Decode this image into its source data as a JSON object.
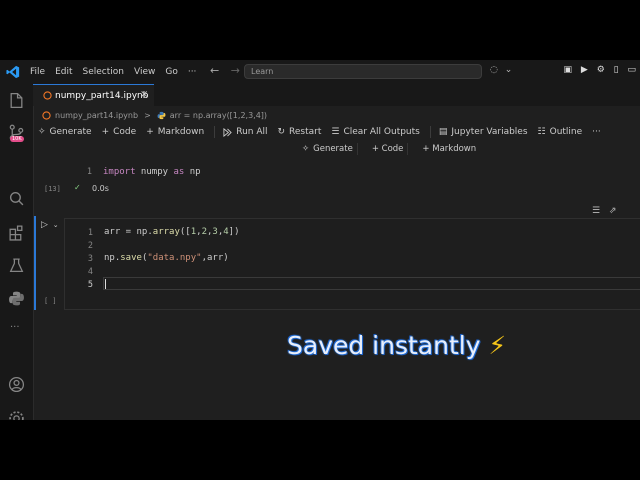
{
  "titlebar": {
    "menu": [
      "File",
      "Edit",
      "Selection",
      "View",
      "Go",
      "···"
    ],
    "search_placeholder": "Learn"
  },
  "tab": {
    "filename": "numpy_part14.ipynb",
    "close": "×"
  },
  "breadcrumb": {
    "file": "numpy_part14.ipynb",
    "sep": ">",
    "cell": "arr = np.array([1,2,3,4])"
  },
  "toolbar": {
    "generate": "Generate",
    "code": "Code",
    "markdown": "Markdown",
    "run_all": "Run All",
    "restart": "Restart",
    "clear_outputs": "Clear All Outputs",
    "jupyter_variables": "Jupyter Variables",
    "outline": "Outline",
    "more": "···"
  },
  "cell_add": {
    "generate": "Generate",
    "code": "+ Code",
    "markdown": "+ Markdown"
  },
  "cell1": {
    "exec_count": "[13]",
    "line_no": "1",
    "tokens": {
      "kw1": "import",
      "mod": " numpy ",
      "kw2": "as",
      "alias": " np"
    },
    "status_time": "0.0s"
  },
  "cell2": {
    "exec_count": "[ ]",
    "line_numbers": [
      "1",
      "2",
      "3",
      "4",
      "5"
    ],
    "line1": {
      "a": "arr = np.",
      "fn": "array",
      "b": "([",
      "n1": "1",
      "c1": ",",
      "n2": "2",
      "c2": ",",
      "n3": "3",
      "c3": ",",
      "n4": "4",
      "e": "])"
    },
    "line3": {
      "a": "np.",
      "fn": "save",
      "b": "(",
      "s": "\"data.npy\"",
      "e": ",arr)"
    }
  },
  "caption": {
    "text": "Saved instantly ",
    "emoji": "⚡"
  },
  "colors": {
    "accent": "#2b79d7",
    "keyword": "#c586c0",
    "string": "#ce9178",
    "number": "#b5cea8",
    "function": "#dcdcaa"
  }
}
